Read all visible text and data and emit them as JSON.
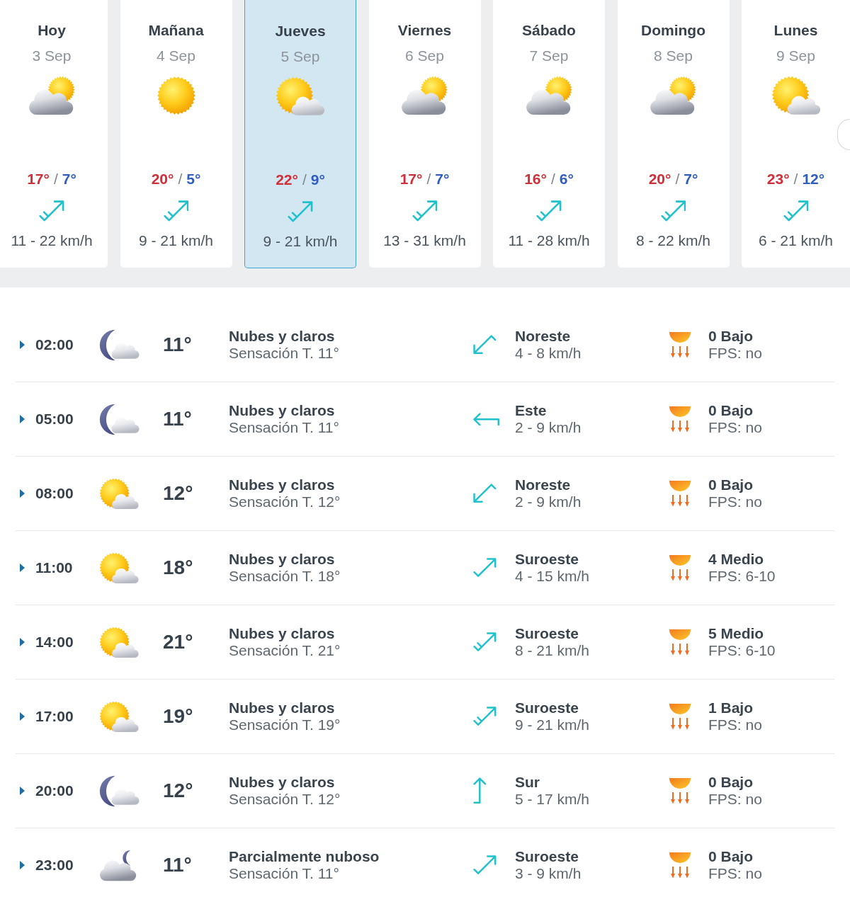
{
  "days": [
    {
      "name": "Hoy",
      "date": "3 Sep",
      "sky": {
        "kind": "cloudy-sun"
      },
      "high": "17°",
      "separator": "/",
      "low": "7°",
      "wind_arrow": {
        "kind": "up-right-two"
      },
      "wind": "11 - 22 km/h",
      "selected": false
    },
    {
      "name": "Mañana",
      "date": "4 Sep",
      "sky": {
        "kind": "sunny"
      },
      "high": "20°",
      "separator": "/",
      "low": "5°",
      "wind_arrow": {
        "kind": "up-right-two"
      },
      "wind": "9 - 21 km/h",
      "selected": false
    },
    {
      "name": "Jueves",
      "date": "5 Sep",
      "sky": {
        "kind": "sun-cloud"
      },
      "high": "22°",
      "separator": "/",
      "low": "9°",
      "wind_arrow": {
        "kind": "up-right-two"
      },
      "wind": "9 - 21 km/h",
      "selected": true
    },
    {
      "name": "Viernes",
      "date": "6 Sep",
      "sky": {
        "kind": "cloudy-sun"
      },
      "high": "17°",
      "separator": "/",
      "low": "7°",
      "wind_arrow": {
        "kind": "up-right-two"
      },
      "wind": "13 - 31 km/h",
      "selected": false
    },
    {
      "name": "Sábado",
      "date": "7 Sep",
      "sky": {
        "kind": "cloudy-sun"
      },
      "high": "16°",
      "separator": "/",
      "low": "6°",
      "wind_arrow": {
        "kind": "up-right-two"
      },
      "wind": "11 - 28 km/h",
      "selected": false
    },
    {
      "name": "Domingo",
      "date": "8 Sep",
      "sky": {
        "kind": "cloudy-sun"
      },
      "high": "20°",
      "separator": "/",
      "low": "7°",
      "wind_arrow": {
        "kind": "up-right-two"
      },
      "wind": "8 - 22 km/h",
      "selected": false
    },
    {
      "name": "Lunes",
      "date": "9 Sep",
      "sky": {
        "kind": "sun-cloud"
      },
      "high": "23°",
      "separator": "/",
      "low": "12°",
      "wind_arrow": {
        "kind": "up-right-two"
      },
      "wind": "6 - 21 km/h",
      "selected": false
    }
  ],
  "hours": [
    {
      "time": "02:00",
      "expanded": false,
      "sky": {
        "kind": "moon-cloud"
      },
      "temp": "11°",
      "summary": "Nubes y claros",
      "feels": "Sensación T. 11°",
      "wind_arrow": {
        "kind": "down-left-one"
      },
      "wind_from": "Noreste",
      "wind": "4 - 8 km/h",
      "uv": "0 Bajo",
      "fps": "FPS: no"
    },
    {
      "time": "05:00",
      "expanded": false,
      "sky": {
        "kind": "moon-cloud"
      },
      "temp": "11°",
      "summary": "Nubes y claros",
      "feels": "Sensación T. 11°",
      "wind_arrow": {
        "kind": "left-one"
      },
      "wind_from": "Este",
      "wind": "2 - 9 km/h",
      "uv": "0 Bajo",
      "fps": "FPS: no"
    },
    {
      "time": "08:00",
      "expanded": false,
      "sky": {
        "kind": "sun-cloud"
      },
      "temp": "12°",
      "summary": "Nubes y claros",
      "feels": "Sensación T. 12°",
      "wind_arrow": {
        "kind": "down-left-one"
      },
      "wind_from": "Noreste",
      "wind": "2 - 9 km/h",
      "uv": "0 Bajo",
      "fps": "FPS: no"
    },
    {
      "time": "11:00",
      "expanded": false,
      "sky": {
        "kind": "sun-cloud"
      },
      "temp": "18°",
      "summary": "Nubes y claros",
      "feels": "Sensación T. 18°",
      "wind_arrow": {
        "kind": "up-right-one"
      },
      "wind_from": "Suroeste",
      "wind": "4 - 15 km/h",
      "uv": "4 Medio",
      "fps": "FPS: 6-10"
    },
    {
      "time": "14:00",
      "expanded": false,
      "sky": {
        "kind": "sun-cloud"
      },
      "temp": "21°",
      "summary": "Nubes y claros",
      "feels": "Sensación T. 21°",
      "wind_arrow": {
        "kind": "up-right-two"
      },
      "wind_from": "Suroeste",
      "wind": "8 - 21 km/h",
      "uv": "5 Medio",
      "fps": "FPS: 6-10"
    },
    {
      "time": "17:00",
      "expanded": false,
      "sky": {
        "kind": "sun-cloud"
      },
      "temp": "19°",
      "summary": "Nubes y claros",
      "feels": "Sensación T. 19°",
      "wind_arrow": {
        "kind": "up-right-two"
      },
      "wind_from": "Suroeste",
      "wind": "9 - 21 km/h",
      "uv": "1 Bajo",
      "fps": "FPS: no"
    },
    {
      "time": "20:00",
      "expanded": false,
      "sky": {
        "kind": "moon-cloud"
      },
      "temp": "12°",
      "summary": "Nubes y claros",
      "feels": "Sensación T. 12°",
      "wind_arrow": {
        "kind": "up-one"
      },
      "wind_from": "Sur",
      "wind": "5 - 17 km/h",
      "uv": "0 Bajo",
      "fps": "FPS: no"
    },
    {
      "time": "23:00",
      "expanded": false,
      "sky": {
        "kind": "cloud-moon"
      },
      "temp": "11°",
      "summary": "Parcialmente nuboso",
      "feels": "Sensación T. 11°",
      "wind_arrow": {
        "kind": "up-right-one"
      },
      "wind_from": "Suroeste",
      "wind": "3 - 9 km/h",
      "uv": "0 Bajo",
      "fps": "FPS: no"
    }
  ]
}
